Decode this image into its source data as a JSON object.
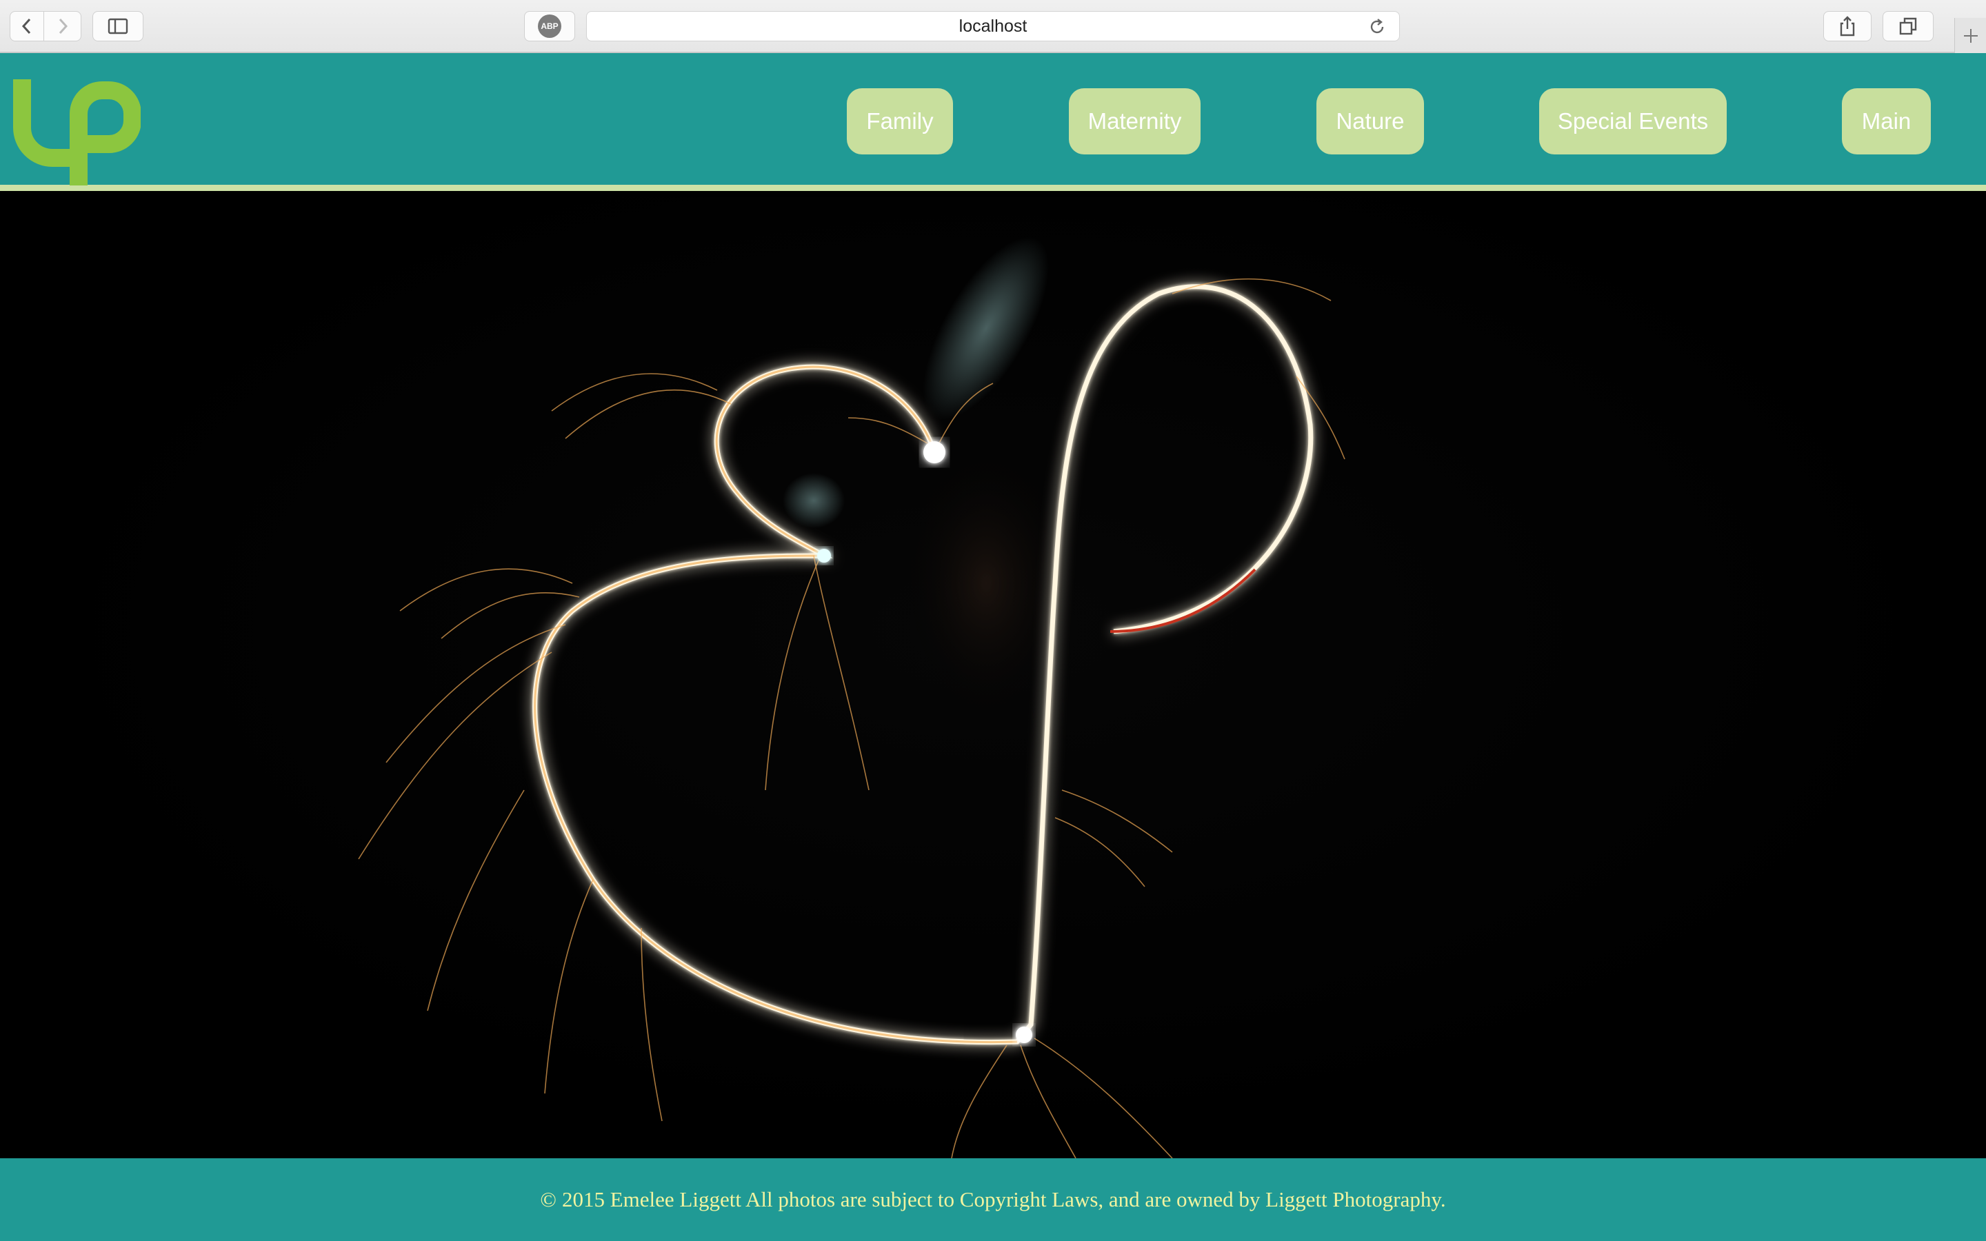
{
  "browser": {
    "url": "localhost",
    "adblock_badge": "ABP"
  },
  "site": {
    "logo_text": "lp",
    "nav": [
      {
        "label": "Family"
      },
      {
        "label": "Maternity"
      },
      {
        "label": "Nature"
      },
      {
        "label": "Special Events"
      },
      {
        "label": "Main"
      }
    ],
    "hero_image": "light-painting-hearts-sparkler",
    "footer": {
      "copyright_symbol": "©",
      "text": "2015 Emelee Liggett All photos are subject to Copyright Laws, and are owned by Liggett Photography."
    }
  },
  "colors": {
    "header_bg": "#209a95",
    "nav_button_bg": "#c8df9d",
    "accent_line": "#cde2a6",
    "logo_green": "#8cc63f",
    "footer_text": "#f0f3a0"
  }
}
